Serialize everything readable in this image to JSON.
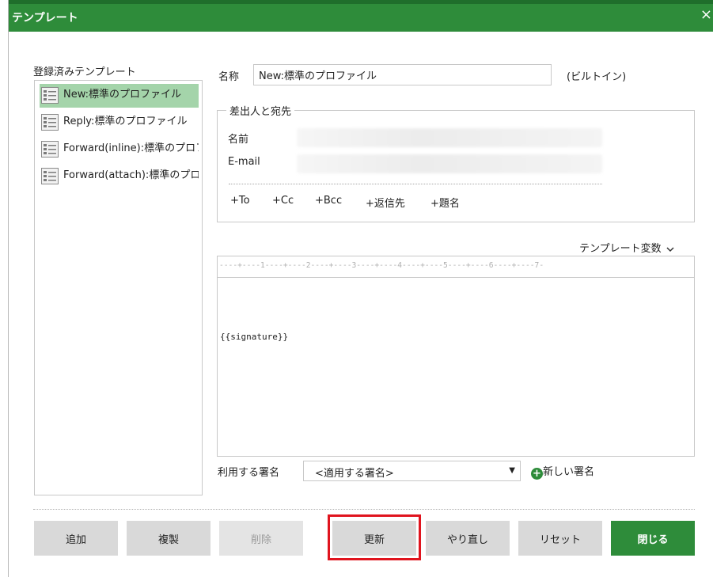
{
  "dialog": {
    "title": "テンプレート",
    "close_symbol": "×"
  },
  "left_panel": {
    "label": "登録済みテンプレート",
    "templates": [
      {
        "label": "New:標準のプロファイル",
        "selected": true
      },
      {
        "label": "Reply:標準のプロファイル",
        "selected": false
      },
      {
        "label": "Forward(inline):標準のプロファイル",
        "selected": false
      },
      {
        "label": "Forward(attach):標準のプロファイル",
        "selected": false
      }
    ]
  },
  "form": {
    "name_label": "名称",
    "name_value": "New:標準のプロファイル",
    "builtin_note": "(ビルトイン)",
    "sender": {
      "legend": "差出人と宛先",
      "name_label": "名前",
      "email_label": "E-mail"
    },
    "add_links": [
      "+To",
      "+Cc",
      "+Bcc",
      "+返信先",
      "+題名"
    ],
    "template_vars_label": "テンプレート変数",
    "template_vars_icon": "chevron-down-icon",
    "editor": {
      "ruler": "----+----1----+----2----+----3----+----4----+----5----+----6----+----7-",
      "body": "{{signature}}"
    },
    "signature": {
      "label": "利用する署名",
      "selected": "<適用する署名>",
      "new_label": "新しい署名"
    }
  },
  "buttons": {
    "add": "追加",
    "duplicate": "複製",
    "delete": "削除",
    "update": "更新",
    "redo": "やり直し",
    "reset": "リセット",
    "close": "閉じる"
  },
  "colors": {
    "titlebar": "#2e8c3a",
    "selected_item": "#a4d4aa",
    "primary_button": "#2e8c3a",
    "highlight": "#e0141e"
  }
}
